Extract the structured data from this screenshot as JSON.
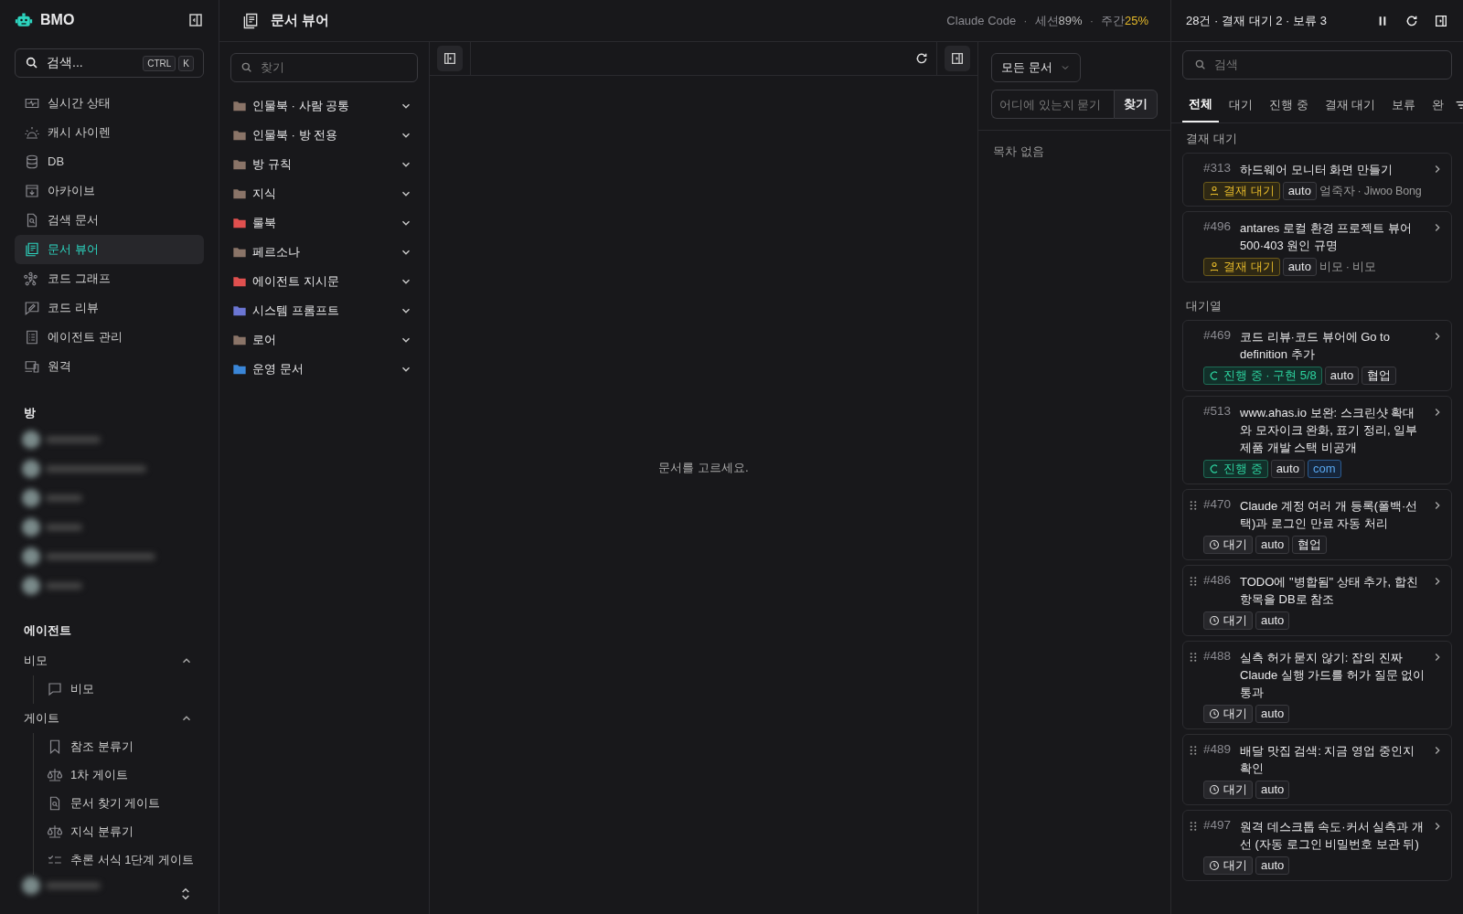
{
  "app": {
    "name": "BMO"
  },
  "search": {
    "placeholder": "검색...",
    "keys": [
      "CTRL",
      "K"
    ]
  },
  "nav": [
    {
      "label": "실시간 상태",
      "selected": false
    },
    {
      "label": "캐시 사이렌",
      "selected": false
    },
    {
      "label": "DB",
      "selected": false
    },
    {
      "label": "아카이브",
      "selected": false
    },
    {
      "label": "검색 문서",
      "selected": false
    },
    {
      "label": "문서 뷰어",
      "selected": true
    },
    {
      "label": "코드 그래프",
      "selected": false
    },
    {
      "label": "코드 리뷰",
      "selected": false
    },
    {
      "label": "에이전트 관리",
      "selected": false
    },
    {
      "label": "원격",
      "selected": false
    }
  ],
  "rooms": {
    "title": "방"
  },
  "agents": {
    "title": "에이전트",
    "groups": [
      {
        "label": "비모",
        "expanded": true,
        "children": [
          {
            "label": "비모"
          }
        ]
      },
      {
        "label": "게이트",
        "expanded": true,
        "children": [
          {
            "label": "참조 분류기"
          },
          {
            "label": "1차 게이트"
          },
          {
            "label": "문서 찾기 게이트"
          },
          {
            "label": "지식 분류기"
          },
          {
            "label": "추론 서식 1단계 게이트"
          }
        ]
      }
    ]
  },
  "page": {
    "title": "문서 뷰어"
  },
  "usage": {
    "label": "Claude Code",
    "separator": "·",
    "meters": [
      {
        "label": "세션",
        "value": "89%",
        "warn": false
      },
      {
        "label": "주간",
        "value": "25%",
        "warn": true
      }
    ]
  },
  "folders": {
    "placeholder": "찾기",
    "items": [
      {
        "label": "인물북 · 사람 공통",
        "color": "#8a7468",
        "expanded": false
      },
      {
        "label": "인물북 · 방 전용",
        "color": "#8a7468",
        "expanded": false
      },
      {
        "label": "방 규칙",
        "color": "#8a7468",
        "expanded": false
      },
      {
        "label": "지식",
        "color": "#8a7468",
        "expanded": false
      },
      {
        "label": "룰북",
        "color": "#e0504f",
        "expanded": false
      },
      {
        "label": "페르소나",
        "color": "#8a7468",
        "expanded": false
      },
      {
        "label": "에이전트 지시문",
        "color": "#e0504f",
        "expanded": false
      },
      {
        "label": "시스템 프롬프트",
        "color": "#6b76d4",
        "expanded": false
      },
      {
        "label": "로어",
        "color": "#8a7468",
        "expanded": false
      },
      {
        "label": "운영 문서",
        "color": "#3a86d8",
        "expanded": false
      }
    ]
  },
  "viewer": {
    "empty": "문서를 고르세요.",
    "left_panel_open": true,
    "right_panel_open": true
  },
  "toc": {
    "scope": "모든 문서",
    "ask_placeholder": "어디에 있는지 묻기",
    "ask_button": "찾기",
    "empty": "목차 없음"
  },
  "tasks": {
    "summary": "28건 · 결재 대기 2 · 보류 3",
    "paused": false,
    "placeholder": "검색",
    "tabs": [
      {
        "label": "전체",
        "selected": true
      },
      {
        "label": "대기",
        "selected": false
      },
      {
        "label": "진행 중",
        "selected": false
      },
      {
        "label": "결재 대기",
        "selected": false
      },
      {
        "label": "보류",
        "selected": false
      },
      {
        "label": "완",
        "selected": false
      }
    ],
    "sections": [
      {
        "title": "결재 대기",
        "cards": [
          {
            "num": "#313",
            "title": "하드웨어 모니터 화면 만들기",
            "draggable": false,
            "tags": [
              {
                "kind": "approval",
                "text": "결재 대기"
              },
              {
                "kind": "plain",
                "text": "auto"
              }
            ],
            "meta": "얼죽자 · Jiwoo Bong"
          },
          {
            "num": "#496",
            "title": "antares 로컬 환경 프로젝트 뷰어 500·403 원인 규명",
            "draggable": false,
            "tags": [
              {
                "kind": "approval",
                "text": "결재 대기"
              },
              {
                "kind": "plain",
                "text": "auto"
              }
            ],
            "meta": "비모 · 비모"
          }
        ]
      },
      {
        "title": "대기열",
        "cards": [
          {
            "num": "#469",
            "title": "코드 리뷰·코드 뷰어에 Go to definition 추가",
            "draggable": false,
            "tags": [
              {
                "kind": "progress",
                "text": "진행 중 · 구현 5/8"
              },
              {
                "kind": "plain",
                "text": "auto"
              },
              {
                "kind": "plain",
                "text": "협업"
              }
            ]
          },
          {
            "num": "#513",
            "title": "www.ahas.io 보완: 스크린샷 확대와 모자이크 완화, 표기 정리, 일부 제품 개발 스택 비공개",
            "draggable": false,
            "tags": [
              {
                "kind": "progress",
                "text": "진행 중"
              },
              {
                "kind": "plain",
                "text": "auto"
              },
              {
                "kind": "link",
                "text": "com"
              }
            ]
          },
          {
            "num": "#470",
            "title": "Claude 계정 여러 개 등록(폴백·선택)과 로그인 만료 자동 처리",
            "draggable": true,
            "tags": [
              {
                "kind": "waiting",
                "text": "대기"
              },
              {
                "kind": "plain",
                "text": "auto"
              },
              {
                "kind": "plain",
                "text": "협업"
              }
            ]
          },
          {
            "num": "#486",
            "title": "TODO에 \"병합됨\" 상태 추가, 합친 항목을 DB로 참조",
            "draggable": true,
            "tags": [
              {
                "kind": "waiting",
                "text": "대기"
              },
              {
                "kind": "plain",
                "text": "auto"
              }
            ]
          },
          {
            "num": "#488",
            "title": "실측 허가 묻지 않기: 잡의 진짜 Claude 실행 가드를 허가 질문 없이 통과",
            "draggable": true,
            "tags": [
              {
                "kind": "waiting",
                "text": "대기"
              },
              {
                "kind": "plain",
                "text": "auto"
              }
            ]
          },
          {
            "num": "#489",
            "title": "배달 맛집 검색: 지금 영업 중인지 확인",
            "draggable": true,
            "tags": [
              {
                "kind": "waiting",
                "text": "대기"
              },
              {
                "kind": "plain",
                "text": "auto"
              }
            ]
          },
          {
            "num": "#497",
            "title": "원격 데스크톱 속도·커서 실측과 개선 (자동 로그인 비밀번호 보관 뒤)",
            "draggable": true,
            "tags": [
              {
                "kind": "waiting",
                "text": "대기"
              },
              {
                "kind": "plain",
                "text": "auto"
              }
            ]
          }
        ]
      }
    ]
  }
}
